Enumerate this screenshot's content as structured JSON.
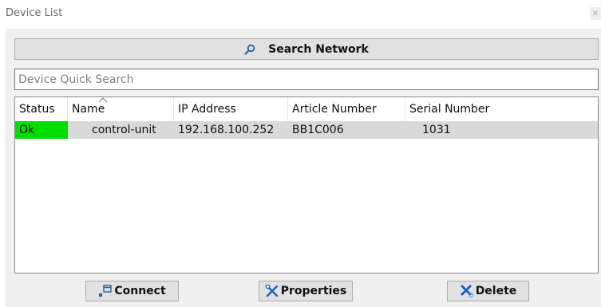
{
  "window": {
    "title": "Device List",
    "close_glyph": "✕"
  },
  "toolbar": {
    "search_network_label": "Search Network",
    "search_icon": "magnifier-icon"
  },
  "quick_search": {
    "placeholder": "Device Quick Search",
    "value": ""
  },
  "table": {
    "columns": [
      "Status",
      "Name",
      "IP Address",
      "Article Number",
      "Serial Number"
    ],
    "sort_column": "Name",
    "sort_direction": "ascending",
    "rows": [
      {
        "status": "Ok",
        "name": "control-unit",
        "ip": "192.168.100.252",
        "article": "BB1C006",
        "serial": "1031"
      }
    ]
  },
  "actions": {
    "connect_label": "Connect",
    "properties_label": "Properties",
    "delete_label": "Delete"
  },
  "colors": {
    "status_ok": "#00dd00",
    "row_selected": "#d9d9d9",
    "icon_blue": "#1f5fbf"
  }
}
